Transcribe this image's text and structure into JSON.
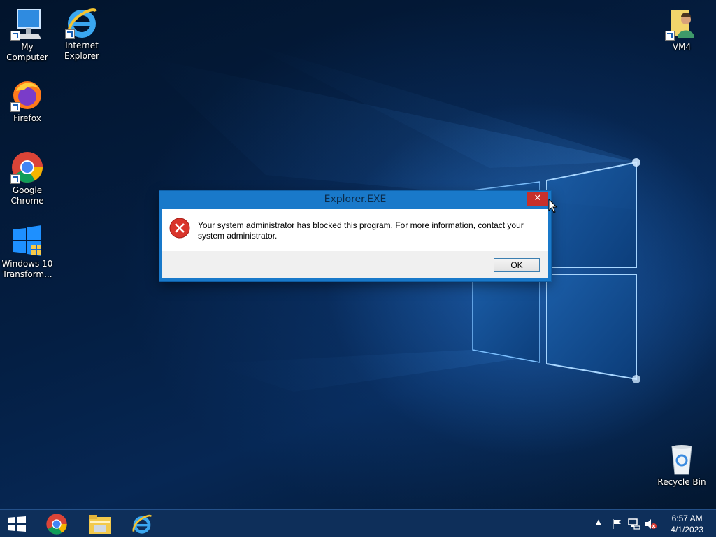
{
  "desktop": {
    "icons": [
      {
        "label": "My Computer"
      },
      {
        "label": "Internet Explorer"
      },
      {
        "label": "Firefox"
      },
      {
        "label": "Google Chrome"
      },
      {
        "label": "Windows 10 Transform..."
      },
      {
        "label": "VM4"
      },
      {
        "label": "Recycle Bin"
      }
    ]
  },
  "dialog": {
    "title": "Explorer.EXE",
    "close_symbol": "✕",
    "message": "Your system administrator has blocked this program. For more information, contact your system administrator.",
    "ok_label": "OK",
    "icon": "error-icon"
  },
  "taskbar": {
    "items": [
      "start-button",
      "chrome-icon",
      "file-explorer-icon",
      "internet-explorer-icon"
    ],
    "clock_time": "6:57 AM",
    "clock_date": "4/1/2023"
  },
  "colors": {
    "title_bar": "#1979ca",
    "taskbar": "#0e2f5a",
    "close_button": "#c7302b"
  }
}
